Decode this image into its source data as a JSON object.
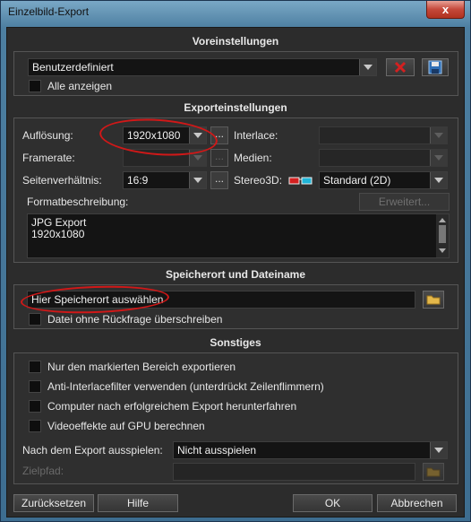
{
  "window": {
    "title": "Einzelbild-Export",
    "close_glyph": "x"
  },
  "presets": {
    "heading": "Voreinstellungen",
    "selected": "Benutzerdefiniert",
    "show_all_label": "Alle anzeigen",
    "show_all_checked": false
  },
  "export_settings": {
    "heading": "Exporteinstellungen",
    "resolution_label": "Auflösung:",
    "resolution_value": "1920x1080",
    "framerate_label": "Framerate:",
    "framerate_value": "",
    "aspect_label": "Seitenverhältnis:",
    "aspect_value": "16:9",
    "interlace_label": "Interlace:",
    "interlace_value": "",
    "media_label": "Medien:",
    "media_value": "",
    "stereo_label": "Stereo3D:",
    "stereo_value": "Standard (2D)",
    "format_desc_label": "Formatbeschreibung:",
    "advanced_button": "Erweitert...",
    "format_desc_line1": "JPG Export",
    "format_desc_line2": "1920x1080",
    "browse_glyph": "..."
  },
  "save_location": {
    "heading": "Speicherort und Dateiname",
    "path_value": "Hier Speicherort auswählen",
    "overwrite_label": "Datei ohne Rückfrage überschreiben"
  },
  "misc": {
    "heading": "Sonstiges",
    "options": [
      {
        "label": "Nur den markierten Bereich exportieren",
        "checked": false
      },
      {
        "label": "Anti-Interlacefilter verwenden (unterdrückt Zeilenflimmern)",
        "checked": false
      },
      {
        "label": "Computer nach erfolgreichem Export herunterfahren",
        "checked": false
      },
      {
        "label": "Videoeffekte auf GPU berechnen",
        "checked": false
      }
    ],
    "play_after_label": "Nach dem Export ausspielen:",
    "play_after_value": "Nicht ausspielen",
    "target_path_label": "Zielpfad:",
    "target_path_value": ""
  },
  "footer": {
    "reset_button": "Zurücksetzen",
    "help_button": "Hilfe",
    "ok_button": "OK",
    "cancel_button": "Abbrechen"
  },
  "colors": {
    "annotation_red": "#d01818",
    "delete_red": "#d42020",
    "save_blue": "#2f6fb5"
  }
}
